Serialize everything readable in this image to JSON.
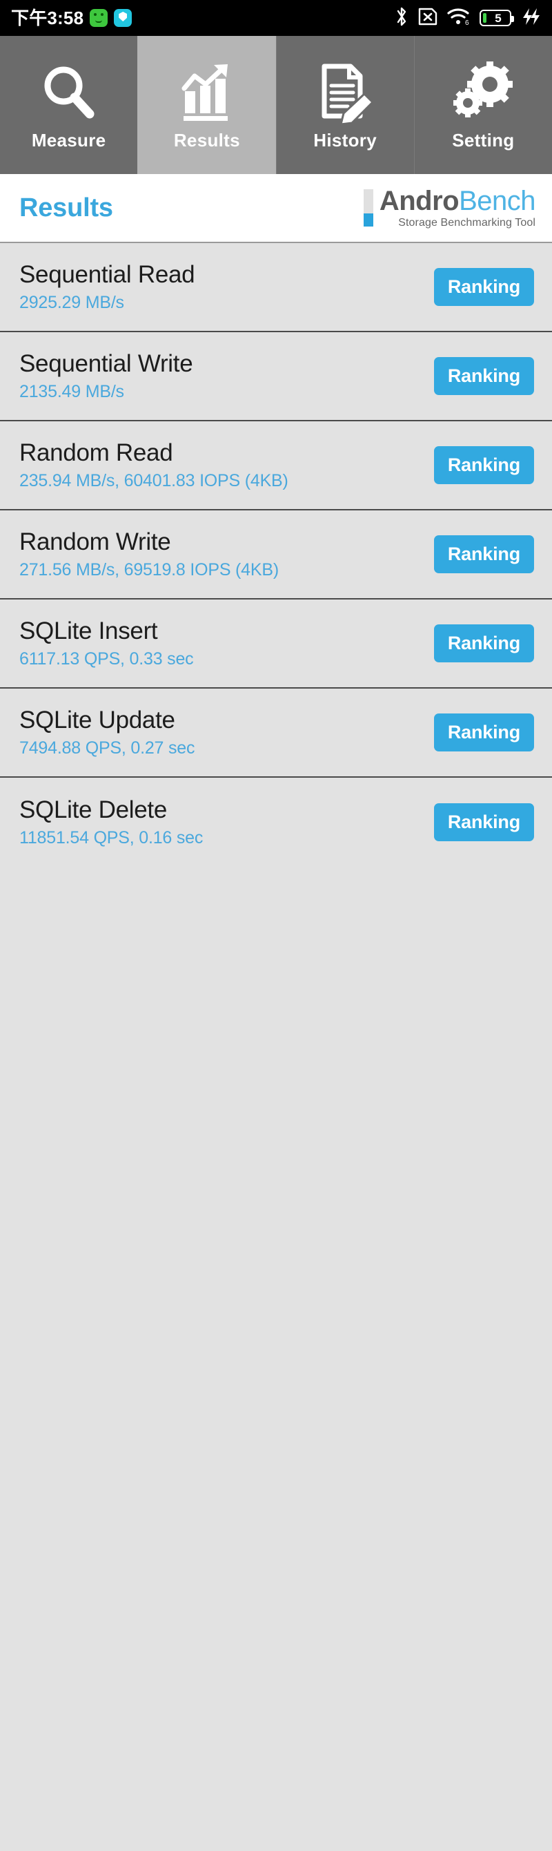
{
  "statusbar": {
    "time": "下午3:58",
    "left_icons": [
      "app-green-icon",
      "shield-cyan-icon"
    ],
    "right_icons": [
      "bluetooth-icon",
      "sim-card-off-icon",
      "wifi-6-icon"
    ],
    "battery_percent": "5",
    "charging_icon": "fast-charging-bolt-icon",
    "wifi_generation": "6"
  },
  "tabs": [
    {
      "label": "Measure",
      "icon": "magnifier-icon",
      "active": false
    },
    {
      "label": "Results",
      "icon": "bar-chart-trend-icon",
      "active": true
    },
    {
      "label": "History",
      "icon": "document-pencil-icon",
      "active": false
    },
    {
      "label": "Setting",
      "icon": "gears-icon",
      "active": false
    }
  ],
  "header": {
    "title": "Results",
    "logo": {
      "name_part1": "Andro",
      "name_part2": "Bench",
      "tagline": "Storage Benchmarking Tool"
    }
  },
  "results": {
    "button_label": "Ranking",
    "items": [
      {
        "name": "Sequential Read",
        "value": "2925.29 MB/s"
      },
      {
        "name": "Sequential Write",
        "value": "2135.49 MB/s"
      },
      {
        "name": "Random Read",
        "value": "235.94 MB/s, 60401.83 IOPS (4KB)"
      },
      {
        "name": "Random Write",
        "value": "271.56 MB/s, 69519.8 IOPS (4KB)"
      },
      {
        "name": "SQLite Insert",
        "value": "6117.13 QPS, 0.33 sec"
      },
      {
        "name": "SQLite Update",
        "value": "7494.88 QPS, 0.27 sec"
      },
      {
        "name": "SQLite Delete",
        "value": "11851.54 QPS, 0.16 sec"
      }
    ]
  },
  "colors": {
    "accent_blue": "#32a9e0",
    "value_blue": "#4aa8dd",
    "tab_inactive": "#6b6b6b",
    "tab_active": "#b5b5b5",
    "list_bg": "#e2e2e2",
    "battery_green": "#43d34b"
  }
}
